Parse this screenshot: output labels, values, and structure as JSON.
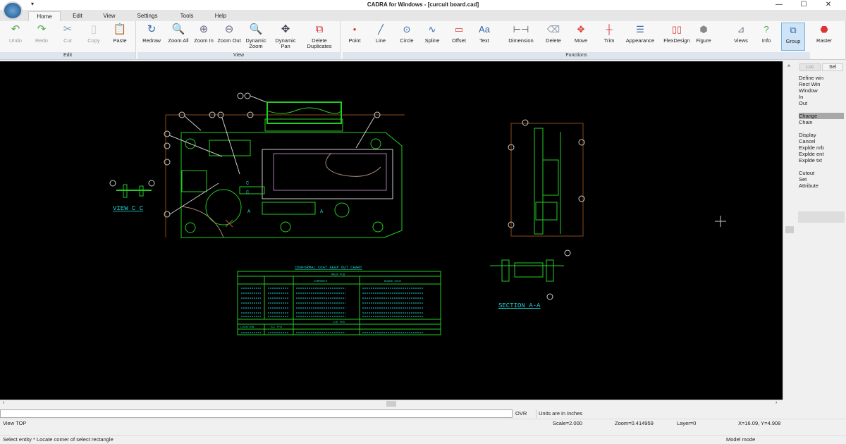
{
  "window": {
    "title": "CADRA for Windows - [curcuit board.cad]",
    "quick_access": "▾",
    "minimize": "—",
    "maximize": "☐",
    "close": "✕"
  },
  "tabs": [
    "Home",
    "Edit",
    "View",
    "Settings",
    "Tools",
    "Help"
  ],
  "ribbon": {
    "edit": {
      "label": "Edit",
      "buttons": [
        {
          "label": "Undo",
          "icon": "undo-icon"
        },
        {
          "label": "Redo",
          "icon": "redo-icon"
        },
        {
          "label": "Cut",
          "icon": "scissors-icon"
        },
        {
          "label": "Copy",
          "icon": "copy-icon"
        },
        {
          "label": "Paste",
          "icon": "paste-icon"
        }
      ]
    },
    "view": {
      "label": "View",
      "buttons": [
        {
          "label": "Redraw",
          "icon": "redraw-icon"
        },
        {
          "label": "Zoom All",
          "icon": "zoom-all-icon"
        },
        {
          "label": "Zoom In",
          "icon": "zoom-in-icon"
        },
        {
          "label": "Zoom Out",
          "icon": "zoom-out-icon"
        },
        {
          "label": "Dynamic Zoom",
          "icon": "dynamic-zoom-icon"
        },
        {
          "label": "Dynamic Pan",
          "icon": "pan-icon"
        },
        {
          "label": "Delete Duplicates",
          "icon": "delete-duplicates-icon"
        }
      ]
    },
    "functions": {
      "label": "Functions",
      "buttons": [
        {
          "label": "Point"
        },
        {
          "label": "Line"
        },
        {
          "label": "Circle"
        },
        {
          "label": "Spline"
        },
        {
          "label": "Offset"
        },
        {
          "label": "Text"
        },
        {
          "label": "Dimension"
        },
        {
          "label": "Delete"
        },
        {
          "label": "Move"
        },
        {
          "label": "Trim"
        },
        {
          "label": "Appearance"
        },
        {
          "label": "FlexDesign"
        },
        {
          "label": "Figure"
        },
        {
          "label": "Views"
        },
        {
          "label": "Info"
        },
        {
          "label": "Group",
          "selected": true
        },
        {
          "label": "Raster"
        }
      ]
    }
  },
  "drawing": {
    "view_cc": "VIEW C C",
    "section_aa": "SECTION A-A",
    "marker_a": "A",
    "marker_c": "C",
    "chart_title": "CONFORMAL COAT KEEP OUT CHART",
    "main_pcb": "MAIN PCB",
    "lcd_pcb": "LCD PCB",
    "col_comments": "COMMENTS",
    "col_board_side": "BOARD SIDE",
    "col_location": "LOCATION",
    "col_pn": "TCC P/N"
  },
  "side_panel": {
    "tabs": [
      "Loc",
      "Sel"
    ],
    "items": [
      "Define win",
      "Rect   Win",
      "Window",
      " In",
      " Out",
      "",
      "Change",
      "Chain",
      "",
      "Display",
      "Cancel",
      "Explde nrb",
      "Explde ent",
      "Explde txt",
      "",
      "Cutout",
      "Set",
      "Attribute"
    ],
    "highlighted": "Change"
  },
  "command": {
    "value": "",
    "ovr": "OVR",
    "units": "Units are in Inches"
  },
  "status": {
    "view": "View TOP",
    "scale": "Scale=2.000",
    "zoom": "Zoom=0.414959",
    "layer": "Layer=0",
    "coords": "X=16.09, Y=4.908",
    "prompt": "Select entity * Locate corner of select rectangle",
    "mode": "Model mode"
  },
  "colors": {
    "canvas": "#000000",
    "green": "#22cc22",
    "cyan": "#22cccc",
    "brown": "#8a4a1a",
    "selected": "#cfe4f7"
  }
}
